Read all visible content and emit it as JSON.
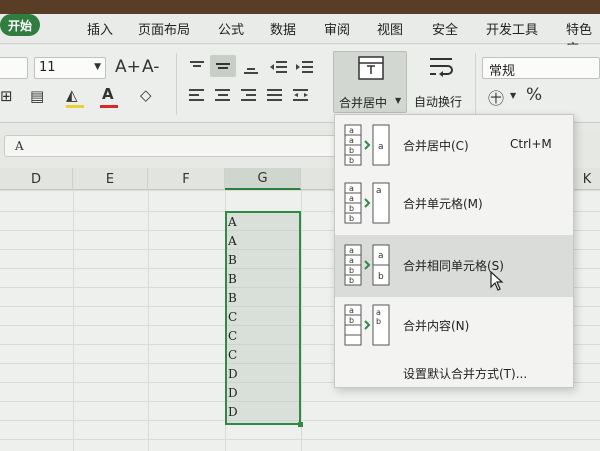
{
  "menu": {
    "home": "开始",
    "items": [
      "插入",
      "页面布局",
      "公式",
      "数据",
      "审阅",
      "视图",
      "安全",
      "开发工具",
      "特色应"
    ]
  },
  "ribbon": {
    "font_size": "11",
    "merge_center_label": "合并居中",
    "wrap_text_label": "自动换行",
    "number_format": "常规",
    "percent_glyph": "%",
    "font_grow": "A+",
    "font_shrink": "A-"
  },
  "formula_bar": {
    "value": "A"
  },
  "columns": [
    "D",
    "E",
    "F",
    "G"
  ],
  "right_col_fragment": "K",
  "cells_G": [
    "A",
    "A",
    "B",
    "B",
    "B",
    "C",
    "C",
    "C",
    "D",
    "D",
    "D"
  ],
  "dropdown": {
    "items": [
      {
        "label": "合并居中(C)",
        "shortcut": "Ctrl+M"
      },
      {
        "label": "合并单元格(M)",
        "shortcut": ""
      },
      {
        "label": "合并相同单元格(S)",
        "shortcut": ""
      },
      {
        "label": "合并内容(N)",
        "shortcut": ""
      }
    ],
    "default_setting": "设置默认合并方式(T)..."
  },
  "colors": {
    "accent": "#2f7d3f",
    "selection": "#2f8a44"
  }
}
